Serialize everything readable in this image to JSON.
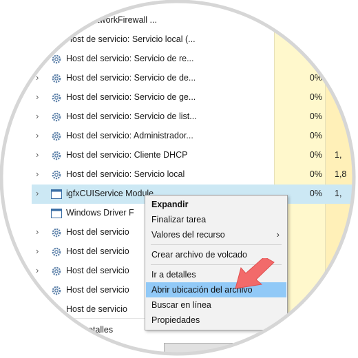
{
  "processes": [
    {
      "name": "ceNoNetworkFirewall ...",
      "cpu": "",
      "mem": "",
      "expander": false,
      "icon": "gear-icon"
    },
    {
      "name": "Host de servicio: Servicio local (...",
      "cpu": "",
      "mem": "",
      "expander": true,
      "icon": "gear-icon"
    },
    {
      "name": "Host del servicio: Servicio de re...",
      "cpu": "",
      "mem": "",
      "expander": true,
      "icon": "gear-icon"
    },
    {
      "name": "Host del servicio: Servicio de de...",
      "cpu": "0%",
      "mem": "",
      "expander": true,
      "icon": "gear-icon"
    },
    {
      "name": "Host del servicio: Servicio de ge...",
      "cpu": "0%",
      "mem": "",
      "expander": true,
      "icon": "gear-icon"
    },
    {
      "name": "Host del servicio: Servicio de list...",
      "cpu": "0%",
      "mem": "",
      "expander": true,
      "icon": "gear-icon"
    },
    {
      "name": "Host del servicio: Administrador...",
      "cpu": "0%",
      "mem": "",
      "expander": true,
      "icon": "gear-icon"
    },
    {
      "name": "Host del servicio: Cliente DHCP",
      "cpu": "0%",
      "mem": "1,",
      "expander": true,
      "icon": "gear-icon"
    },
    {
      "name": "Host del servicio: Servicio local",
      "cpu": "0%",
      "mem": "1,8",
      "expander": true,
      "icon": "gear-icon"
    },
    {
      "name": "igfxCUIService Module",
      "cpu": "0%",
      "mem": "1,",
      "expander": true,
      "icon": "app-window-icon",
      "selected": true
    },
    {
      "name": "Windows Driver F",
      "cpu": "",
      "mem": "",
      "expander": false,
      "icon": "app-window-icon"
    },
    {
      "name": "Host del servicio",
      "cpu": "",
      "mem": "",
      "expander": true,
      "icon": "gear-icon"
    },
    {
      "name": "Host del servicio",
      "cpu": "",
      "mem": "",
      "expander": true,
      "icon": "gear-icon"
    },
    {
      "name": "Host del servicio",
      "cpu": "",
      "mem": "",
      "expander": true,
      "icon": "gear-icon"
    },
    {
      "name": "Host del servicio",
      "cpu": "",
      "mem": "",
      "expander": true,
      "icon": "gear-icon"
    },
    {
      "name": "Host de servicio",
      "cpu": "",
      "mem": "",
      "expander": true,
      "icon": "gear-icon"
    }
  ],
  "footer": {
    "details_label": "etalles"
  },
  "context_menu": {
    "expand": "Expandir",
    "end_task": "Finalizar tarea",
    "resource_values": "Valores del recurso",
    "dump_file": "Crear archivo de volcado",
    "go_to_details": "Ir a detalles",
    "open_file_location": "Abrir ubicación del archivo",
    "search_online": "Buscar en línea",
    "properties": "Propiedades",
    "submenu_arrow": "›"
  },
  "colors": {
    "selection": "#cce8f4",
    "menu_highlight": "#91c9f7",
    "cpu_column": "#fff8cc",
    "annotation_arrow": "#f26a6a"
  }
}
